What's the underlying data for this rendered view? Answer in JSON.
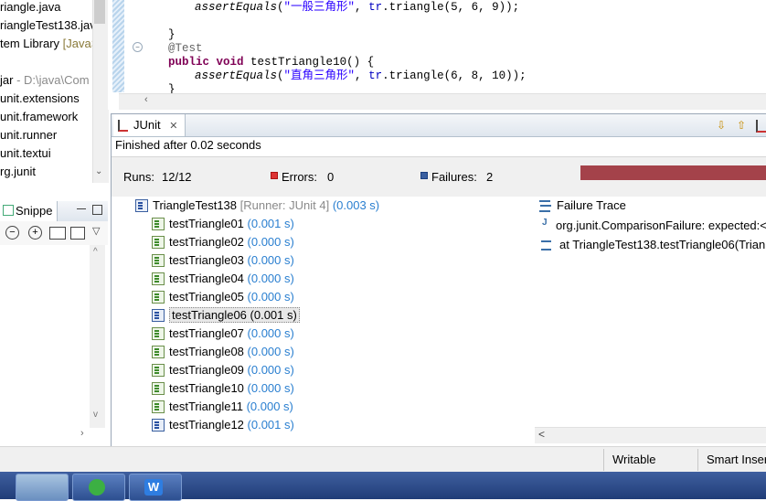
{
  "package_explorer": {
    "items": [
      {
        "label": "riangle.java",
        "suffix": ""
      },
      {
        "label": "riangleTest138.jav",
        "suffix": ""
      },
      {
        "label": "tem Library ",
        "suffix": "[JavaS"
      },
      {
        "label": "",
        "suffix": ""
      },
      {
        "label": "jar",
        "suffix": " - D:\\java\\Com"
      },
      {
        "label": "unit.extensions",
        "suffix": ""
      },
      {
        "label": "unit.framework",
        "suffix": ""
      },
      {
        "label": "unit.runner",
        "suffix": ""
      },
      {
        "label": "unit.textui",
        "suffix": ""
      },
      {
        "label": "rg.junit",
        "suffix": ""
      }
    ]
  },
  "editor": {
    "lines": [
      {
        "kind": "assert",
        "indent": "    ",
        "call": "assertEquals",
        "str": "\"一般三角形\"",
        "rest": ", ",
        "field": "tr",
        "tail": ".triangle(5, 6, 9));"
      },
      {
        "kind": "plain",
        "text": "}"
      },
      {
        "kind": "annotation",
        "text": "@Test"
      },
      {
        "kind": "method",
        "kw1": "public",
        "kw2": "void",
        "name": " testTriangle10() {"
      },
      {
        "kind": "assert",
        "indent": "    ",
        "call": "assertEquals",
        "str": "\"直角三角形\"",
        "rest": ", ",
        "field": "tr",
        "tail": ".triangle(6, 8, 10));"
      },
      {
        "kind": "plain",
        "text": "}"
      }
    ]
  },
  "junit": {
    "tab_label": "JUnit",
    "status": "Finished after 0.02 seconds",
    "runs_label": "Runs:",
    "runs_value": "12/12",
    "errors_label": "Errors:",
    "errors_value": "0",
    "failures_label": "Failures:",
    "failures_value": "2",
    "progress_color": "#a4424a",
    "root": {
      "name": "TriangleTest138",
      "runner": "[Runner: JUnit 4]",
      "time": "(0.003 s)"
    },
    "tests": [
      {
        "name": "testTriangle01",
        "time": "(0.001 s)",
        "failed": false
      },
      {
        "name": "testTriangle02",
        "time": "(0.000 s)",
        "failed": false
      },
      {
        "name": "testTriangle03",
        "time": "(0.000 s)",
        "failed": false
      },
      {
        "name": "testTriangle04",
        "time": "(0.000 s)",
        "failed": false
      },
      {
        "name": "testTriangle05",
        "time": "(0.000 s)",
        "failed": false
      },
      {
        "name": "testTriangle06",
        "time": "(0.001 s)",
        "failed": true,
        "selected": true
      },
      {
        "name": "testTriangle07",
        "time": "(0.000 s)",
        "failed": false
      },
      {
        "name": "testTriangle08",
        "time": "(0.000 s)",
        "failed": false
      },
      {
        "name": "testTriangle09",
        "time": "(0.000 s)",
        "failed": false
      },
      {
        "name": "testTriangle10",
        "time": "(0.000 s)",
        "failed": false
      },
      {
        "name": "testTriangle11",
        "time": "(0.000 s)",
        "failed": false
      },
      {
        "name": "testTriangle12",
        "time": "(0.001 s)",
        "failed": true
      }
    ],
    "failure_trace": {
      "title": "Failure Trace",
      "lines": [
        "org.junit.ComparisonFailure: expected:<",
        "at TriangleTest138.testTriangle06(Trian"
      ]
    }
  },
  "snippets": {
    "tab_label": "Snippe"
  },
  "statusbar": {
    "mode": "Writable",
    "insert": "Smart Inser"
  }
}
